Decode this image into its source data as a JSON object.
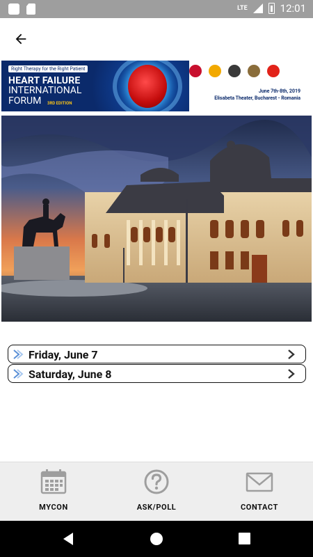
{
  "status_bar": {
    "network": "LTE",
    "time": "12:01"
  },
  "app_bar": {
    "back_icon": "arrow-left-icon"
  },
  "banner": {
    "tagline": "Right Therapy for the Right Patient",
    "title_line1": "HEART FAILURE",
    "title_line2": "INTERNATIONAL",
    "title_line3": "FORUM",
    "edition": "3RD EDITION",
    "date": "June 7th-8th, 2019",
    "venue": "Elisabeta Theater, Bucharest - Romania"
  },
  "hero_image": {
    "alt": "Historic domed library building at dusk with equestrian statue"
  },
  "days": [
    {
      "label": "Friday, June 7"
    },
    {
      "label": "Saturday, June 8"
    }
  ],
  "bottom_nav": [
    {
      "label": "MYCON",
      "icon": "calendar-icon"
    },
    {
      "label": "ASK/POLL",
      "icon": "question-circle-icon"
    },
    {
      "label": "CONTACT",
      "icon": "envelope-icon"
    }
  ],
  "colors": {
    "banner_blue": "#0b2a6b",
    "status_bar": "#9e9e9e",
    "bottom_nav_bg": "#eeeeee",
    "icon_gray": "#9e9e9e"
  }
}
